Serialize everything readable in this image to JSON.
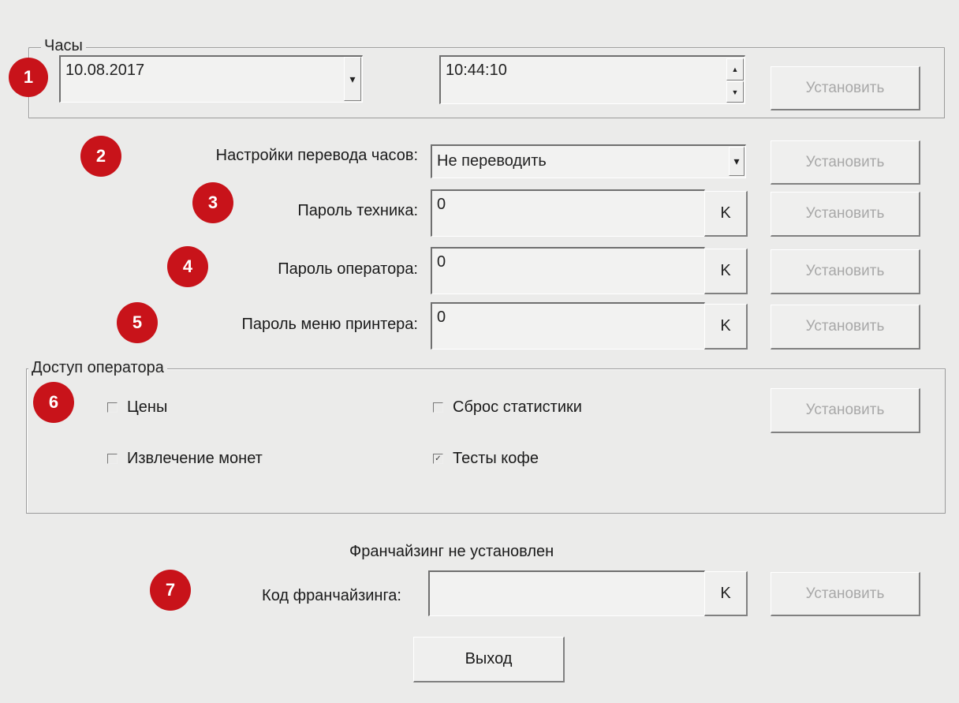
{
  "clock": {
    "legend": "Часы",
    "date_value": "10.08.2017",
    "time_value": "10:44:10",
    "set_label": "Установить"
  },
  "dst": {
    "label": "Настройки перевода часов:",
    "selected": "Не переводить",
    "set_label": "Установить"
  },
  "tech_password": {
    "label": "Пароль техника:",
    "value": "0",
    "k_label": "K",
    "set_label": "Установить"
  },
  "operator_password": {
    "label": "Пароль оператора:",
    "value": "0",
    "k_label": "K",
    "set_label": "Установить"
  },
  "printer_password": {
    "label": "Пароль меню принтера:",
    "value": "0",
    "k_label": "K",
    "set_label": "Установить"
  },
  "operator_access": {
    "legend": "Доступ оператора",
    "set_label": "Установить",
    "options": [
      {
        "label": "Цены",
        "checked": false,
        "mark": ""
      },
      {
        "label": "Сброс статистики",
        "checked": false,
        "mark": ""
      },
      {
        "label": "Извлечение монет",
        "checked": false,
        "mark": ""
      },
      {
        "label": "Тесты кофе",
        "checked": true,
        "mark": "✓"
      }
    ]
  },
  "franchise": {
    "status": "Франчайзинг не установлен",
    "label": "Код франчайзинга:",
    "value": "",
    "k_label": "K",
    "set_label": "Установить"
  },
  "exit_label": "Выход",
  "badges": [
    "1",
    "2",
    "3",
    "4",
    "5",
    "6",
    "7"
  ],
  "colors": {
    "background": "#ebebea",
    "badge": "#c8131a",
    "disabled_text": "#a8a8a8"
  },
  "icons": {
    "dropdown": "▾",
    "spin_up": "▲",
    "spin_down": "▼"
  }
}
